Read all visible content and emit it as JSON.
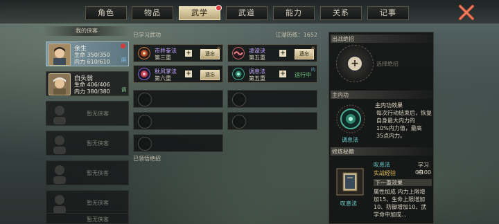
{
  "tabs": [
    {
      "label": "角色",
      "active": false
    },
    {
      "label": "物品",
      "active": false
    },
    {
      "label": "武学",
      "active": true,
      "dot": true
    },
    {
      "label": "武道",
      "active": false
    },
    {
      "label": "能力",
      "active": false
    },
    {
      "label": "关系",
      "active": false
    },
    {
      "label": "记事",
      "active": false
    }
  ],
  "left": {
    "title": "我的侠客",
    "heroes": [
      {
        "name": "余生",
        "hp": "生命 350/350",
        "mp": "内力 610/610",
        "badge": "阴",
        "badge_color": "#7dc8ff",
        "selected": true,
        "alert": true
      },
      {
        "name": "白头翁",
        "hp": "生命 406/406",
        "mp": "内力 380/380",
        "badge": "调",
        "badge_color": "#8fe09a",
        "selected": false,
        "alert": false
      }
    ],
    "empty_label": "暂无侠客",
    "empty_count": 5
  },
  "mid": {
    "learned_title": "已学习武功",
    "points_label": "江湖历练：1652",
    "skills": [
      {
        "name": "市井拳法",
        "level": "第三重",
        "action": "遗忘",
        "name_color": "#c7a4ff",
        "icon_color": "#7a3a2a",
        "corner": "外"
      },
      {
        "name": "凌波诀",
        "level": "第五重",
        "action": "遗忘",
        "name_color": "#c7a4ff",
        "icon_color": "#8a2a3a",
        "corner": "外"
      },
      {
        "name": "秋风掌法",
        "level": "第六重",
        "action": "遗忘",
        "name_color": "#c7a4ff",
        "icon_color": "#5a3a8a",
        "corner": ""
      },
      {
        "name": "调息法",
        "level": "第五重",
        "action": "运行中",
        "name_color": "#c7a4ff",
        "icon_color": "#2a6a5a",
        "corner": "内"
      }
    ],
    "mastered_title": "已领悟绝招"
  },
  "right": {
    "ult_title": "出战绝招",
    "ult_placeholder": "选择绝招",
    "internal_title": "主内功",
    "internal_effect_title": "主内功效果",
    "internal_effect": [
      "每次行动结束后，恢复",
      "自身最大内力的",
      "10%内力值，最高",
      "35点内力。"
    ],
    "internal_name": "调息法",
    "book_title": "修炼秘籍",
    "book_name": "叹息法",
    "book_status": "学习中",
    "exp_label": "实战经验",
    "exp_value": "0/100",
    "next_level": "下一重效果",
    "attr_lines": [
      "属性加成  内力上限增",
      "加15、生命上限增加",
      "10、防御增加10、武",
      "学命中加成..."
    ],
    "book_caption": "叹息法"
  },
  "colors": {
    "accent": "#e6dcc0",
    "running": "#74d18b",
    "exp": "#e8c65a",
    "teal": "#52c6c0"
  }
}
